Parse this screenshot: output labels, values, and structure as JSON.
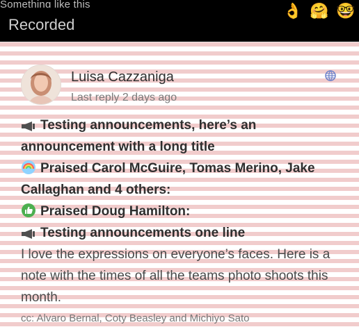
{
  "header": {
    "top_line": "Something like this",
    "sub_label": "Recorded",
    "reactions": [
      {
        "icon": "grinning-sweat-icon",
        "glyph": "😅"
      },
      {
        "icon": "ok-hand-icon",
        "glyph": "👌"
      },
      {
        "icon": "hugging-face-icon",
        "glyph": "🤗"
      },
      {
        "icon": "nerd-face-icon",
        "glyph": "🤓"
      }
    ]
  },
  "post": {
    "author": "Luisa Cazzaniga",
    "last_reply": "Last reply 2 days ago",
    "visibility_icon": "globe-icon",
    "announcement_1": "Testing announcements, here’s an announcement with a long title",
    "praise_1": "Praised Carol McGuire, Tomas Merino, Jake Callaghan and 4 others:",
    "praise_2": "Praised Doug Hamilton:",
    "announcement_2": "Testing announcements one line",
    "body": "I love the expressions on everyone’s faces. Here is a note with the times of all the teams photo shoots this month.",
    "cc": "cc: Alvaro Bernal, Coty Beasley and Michiyo Sato"
  },
  "colors": {
    "stripe": "#d76e6e",
    "thumbs_badge": "#4caf50",
    "rainbow_badge": "#8fd3ff"
  }
}
